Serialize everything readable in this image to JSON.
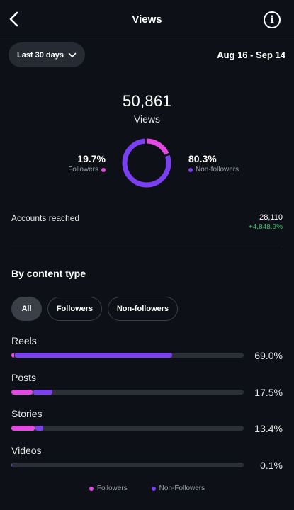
{
  "colors": {
    "followers": "#e449e3",
    "non_followers": "#7a3ff0",
    "positive": "#3ec36b"
  },
  "header": {
    "title": "Views",
    "back_icon": "chevron-left-icon",
    "info_icon": "info-icon"
  },
  "filters": {
    "range_label": "Last 30 days",
    "range_icon": "chevron-down-icon",
    "date_range": "Aug 16 - Sep 14"
  },
  "summary": {
    "total": "50,861",
    "total_label": "Views",
    "followers_pct": "19.7%",
    "followers_label": "Followers",
    "followers_fraction": 0.197,
    "non_followers_pct": "80.3%",
    "non_followers_label": "Non-followers",
    "non_followers_fraction": 0.803
  },
  "reach": {
    "label": "Accounts reached",
    "value": "28,110",
    "delta": "+4,848.9%"
  },
  "content_type": {
    "title": "By content type",
    "tabs": [
      {
        "label": "All",
        "active": true
      },
      {
        "label": "Followers",
        "active": false
      },
      {
        "label": "Non-followers",
        "active": false
      }
    ],
    "rows": [
      {
        "label": "Reels",
        "pct": "69.0%",
        "followers": 0.012,
        "non_followers": 0.678
      },
      {
        "label": "Posts",
        "pct": "17.5%",
        "followers": 0.09,
        "non_followers": 0.085
      },
      {
        "label": "Stories",
        "pct": "13.4%",
        "followers": 0.1,
        "non_followers": 0.034
      },
      {
        "label": "Videos",
        "pct": "0.1%",
        "followers": 0.0,
        "non_followers": 0.001
      }
    ]
  },
  "legend": {
    "followers": "Followers",
    "non_followers": "Non-Followers"
  }
}
